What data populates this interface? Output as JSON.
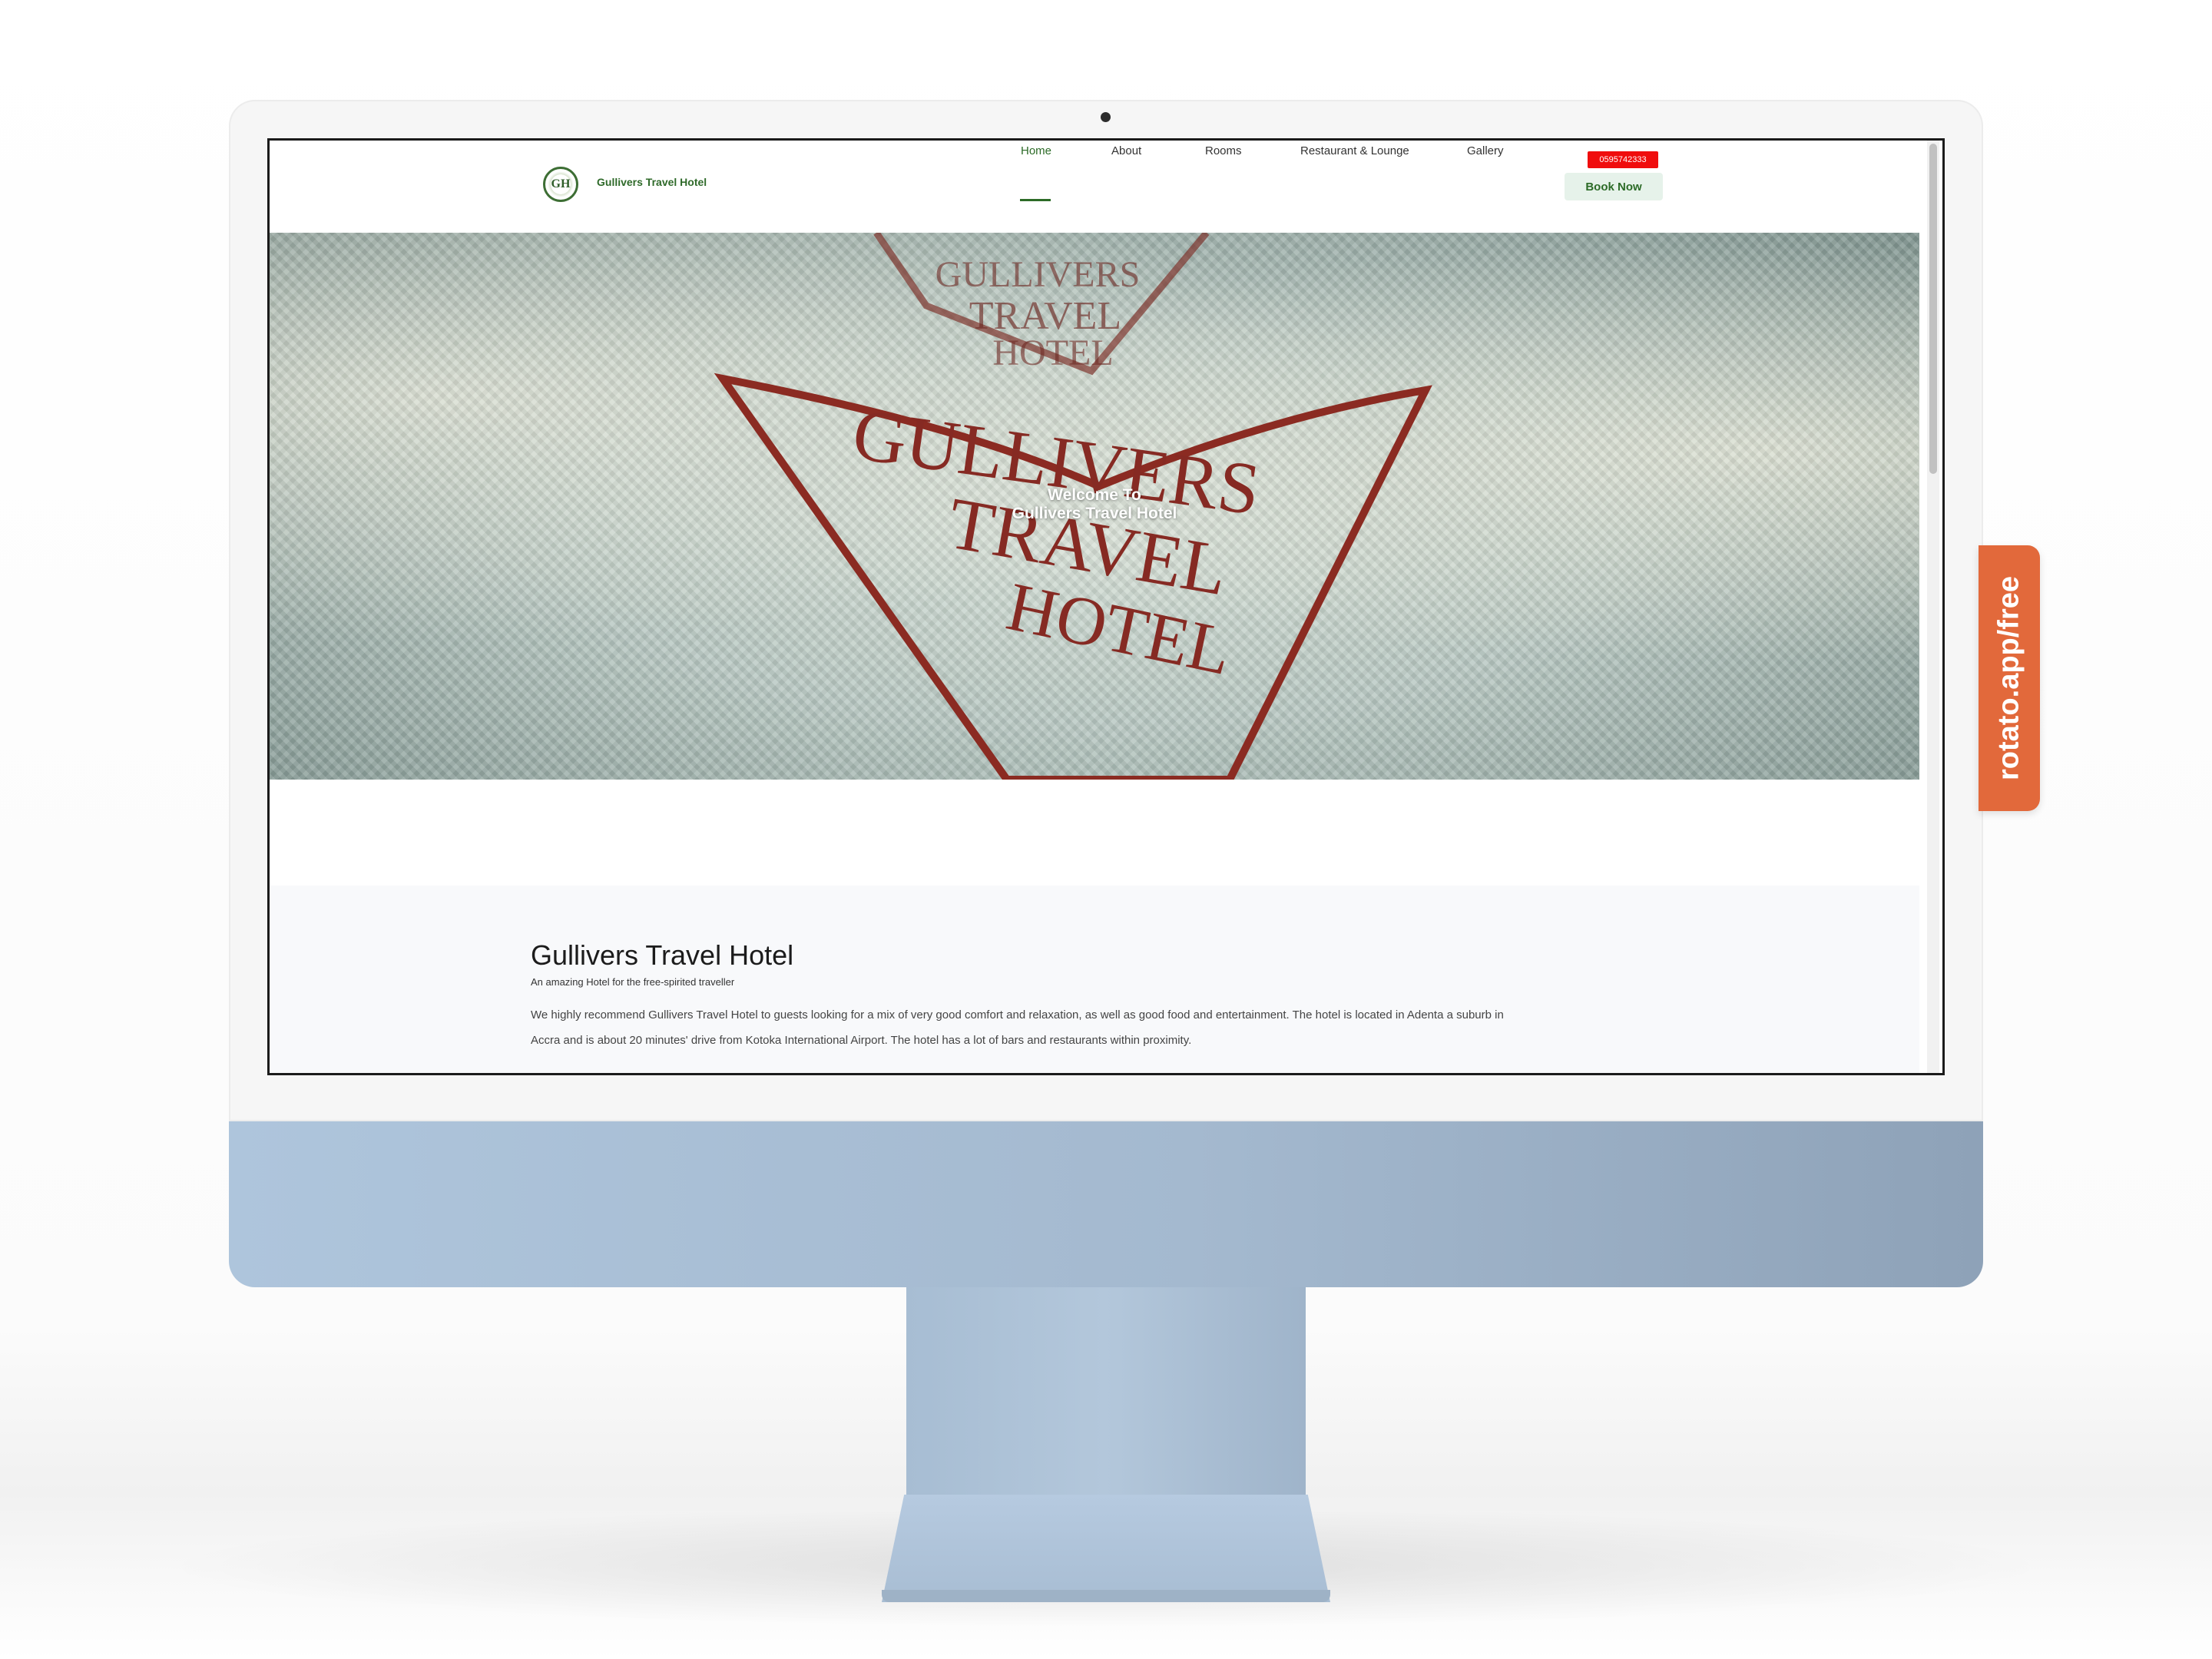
{
  "site": {
    "brand_name": "Gullivers Travel Hotel",
    "logo_text": "GH",
    "phone_badge": "0595742333",
    "nav": [
      "Home",
      "About",
      "Rooms",
      "Restaurant & Lounge",
      "Gallery"
    ],
    "active_nav": "Home",
    "book_now_label": "Book Now",
    "accent_color": "#2c6b27",
    "badge_color": "#f00d0d"
  },
  "hero": {
    "title_line1": "Welcome To",
    "title_line2": "Gullivers Travel Hotel",
    "emblem_top": [
      "GULLIVERS",
      "TRAVEL",
      "HOTEL"
    ],
    "emblem_main": [
      "GULLIVERS",
      "TRAVEL",
      "HOTEL"
    ]
  },
  "about": {
    "title": "Gullivers Travel Hotel",
    "tagline": "An amazing Hotel for the free-spirited traveller",
    "body_line1": "We highly recommend Gullivers Travel Hotel to guests looking for a mix of very good comfort and relaxation, as well as good food and entertainment. The hotel is located in Adenta a suburb in",
    "body_line2": "Accra and is about 20 minutes' drive from Kotoka International Airport. The hotel has a lot of bars and restaurants within proximity."
  },
  "watermark": {
    "text": "rotato.app/free",
    "color": "#e2693b"
  }
}
